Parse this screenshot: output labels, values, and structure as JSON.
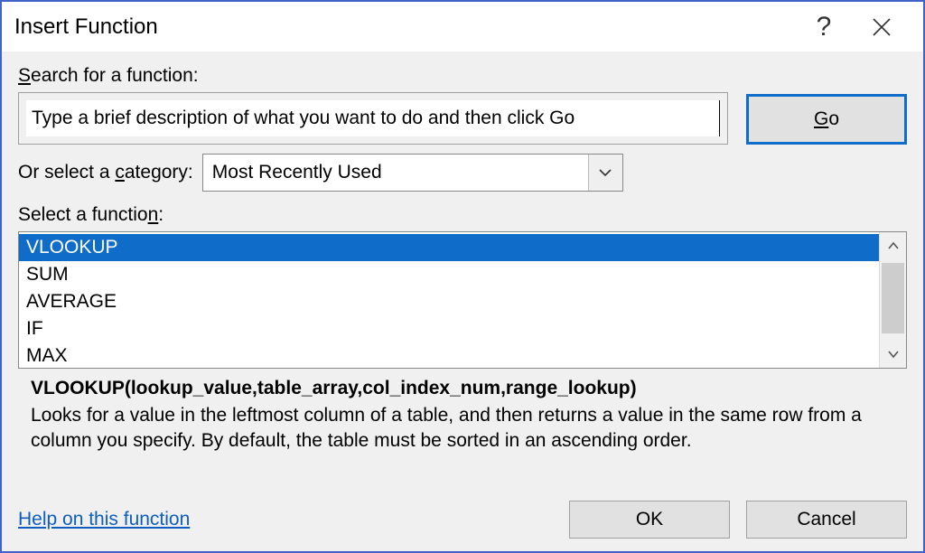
{
  "titlebar": {
    "title": "Insert Function",
    "help_symbol": "?"
  },
  "labels": {
    "search": {
      "pre": "",
      "u": "S",
      "post": "earch for a function:"
    },
    "category": {
      "pre": "Or select a ",
      "u": "c",
      "post": "ategory:"
    },
    "select_fn": {
      "pre": "Select a functio",
      "u": "n",
      "post": ":"
    }
  },
  "search": {
    "value": "Type a brief description of what you want to do and then click Go"
  },
  "go": {
    "u": "G",
    "rest": "o"
  },
  "category": {
    "selected": "Most Recently Used"
  },
  "functions": {
    "items": [
      "VLOOKUP",
      "SUM",
      "AVERAGE",
      "IF",
      "MAX"
    ],
    "selected_index": 0
  },
  "description": {
    "signature": "VLOOKUP(lookup_value,table_array,col_index_num,range_lookup)",
    "text": "Looks for a value in the leftmost column of a table, and then returns a value in the same row from a column you specify. By default, the table must be sorted in an ascending order."
  },
  "footer": {
    "help_link": "Help on this function",
    "ok": "OK",
    "cancel": "Cancel"
  }
}
